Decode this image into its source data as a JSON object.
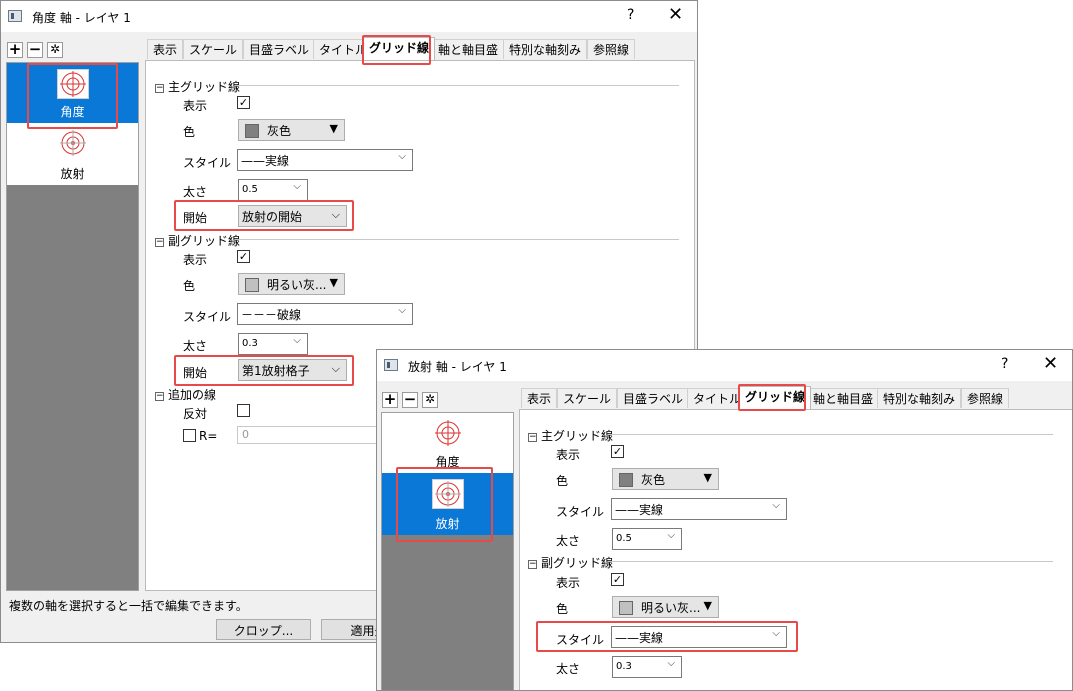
{
  "win1": {
    "title": "角度 軸 - レイヤ 1",
    "help": "?",
    "close": "✕",
    "toolbar": {
      "add": "+",
      "remove": "−",
      "settings": "✲"
    },
    "list_items": [
      "角度",
      "放射"
    ],
    "tabs": [
      "表示",
      "スケール",
      "目盛ラベル",
      "タイトル",
      "グリッド線",
      "軸と軸目盛",
      "特別な軸刻み",
      "参照線"
    ],
    "major": {
      "header": "主グリッド線",
      "show_label": "表示",
      "color_label": "色",
      "color_value": "灰色",
      "color_hex": "#808080",
      "style_label": "スタイル",
      "style_value": "——実線",
      "width_label": "太さ",
      "width_value": "0.5",
      "start_label": "開始",
      "start_value": "放射の開始"
    },
    "minor": {
      "header": "副グリッド線",
      "show_label": "表示",
      "color_label": "色",
      "color_value": "明るい灰...",
      "color_hex": "#c0c0c0",
      "style_label": "スタイル",
      "style_value": "－－－破線",
      "width_label": "太さ",
      "width_value": "0.3",
      "start_label": "開始",
      "start_value": "第1放射格子"
    },
    "extra": {
      "header": "追加の線",
      "reverse_label": "反対",
      "r_label": "R=",
      "r_value": "0"
    },
    "status": "複数の軸を選択すると一括で編集できます。",
    "buttons": [
      "クロップ...",
      "適用先"
    ]
  },
  "win2": {
    "title": "放射 軸 - レイヤ 1",
    "help": "?",
    "close": "✕",
    "toolbar": {
      "add": "+",
      "remove": "−",
      "settings": "✲"
    },
    "list_items": [
      "角度",
      "放射"
    ],
    "tabs": [
      "表示",
      "スケール",
      "目盛ラベル",
      "タイトル",
      "グリッド線",
      "軸と軸目盛",
      "特別な軸刻み",
      "参照線"
    ],
    "major": {
      "header": "主グリッド線",
      "show_label": "表示",
      "color_label": "色",
      "color_value": "灰色",
      "color_hex": "#808080",
      "style_label": "スタイル",
      "style_value": "——実線",
      "width_label": "太さ",
      "width_value": "0.5"
    },
    "minor": {
      "header": "副グリッド線",
      "show_label": "表示",
      "color_label": "色",
      "color_value": "明るい灰...",
      "color_hex": "#c0c0c0",
      "style_label": "スタイル",
      "style_value": "——実線",
      "width_label": "太さ",
      "width_value": "0.3"
    }
  },
  "colors": {
    "selection": "#0a78d7",
    "highlight": "#e84a4a"
  }
}
